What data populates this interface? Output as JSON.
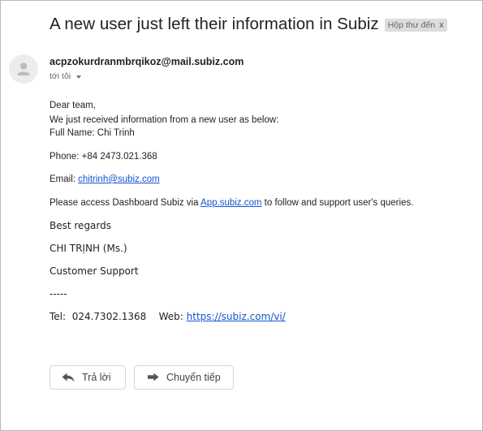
{
  "subject": "A new user just left their information in Subiz",
  "label": {
    "text": "Hộp thư đến",
    "close": "x"
  },
  "sender": {
    "email": "acpzokurdranmbrqikoz@mail.subiz.com",
    "recipient": "tới tôi"
  },
  "body": {
    "greeting": "Dear team,",
    "intro": "We just received information from a new user as below:",
    "full_name_line": "Full Name: Chi Trinh",
    "phone_line": "Phone: +84 2473.021.368",
    "email_prefix": "Email: ",
    "email_link": "chitrinh@subiz.com",
    "access_prefix": "Please access Dashboard Subiz via ",
    "access_link": "App.subiz.com",
    "access_suffix": " to follow and support user's queries."
  },
  "signature": {
    "closing": "Best regards",
    "name": "CHI TRỊNH (Ms.)",
    "role": "Customer Support",
    "separator": "-----",
    "tel_label": "Tel:",
    "tel_value": "024.7302.1368",
    "web_label": "Web:",
    "web_link": "https://subiz.com/vi/"
  },
  "actions": {
    "reply": "Trả lời",
    "forward": "Chuyển tiếp"
  },
  "colors": {
    "link": "#1155cc",
    "chip_bg": "#dddddd",
    "border": "#b9b9b9"
  },
  "icons": [
    "person-avatar-icon",
    "dropdown-caret-icon",
    "reply-arrow-icon",
    "forward-arrow-icon",
    "close-icon"
  ]
}
